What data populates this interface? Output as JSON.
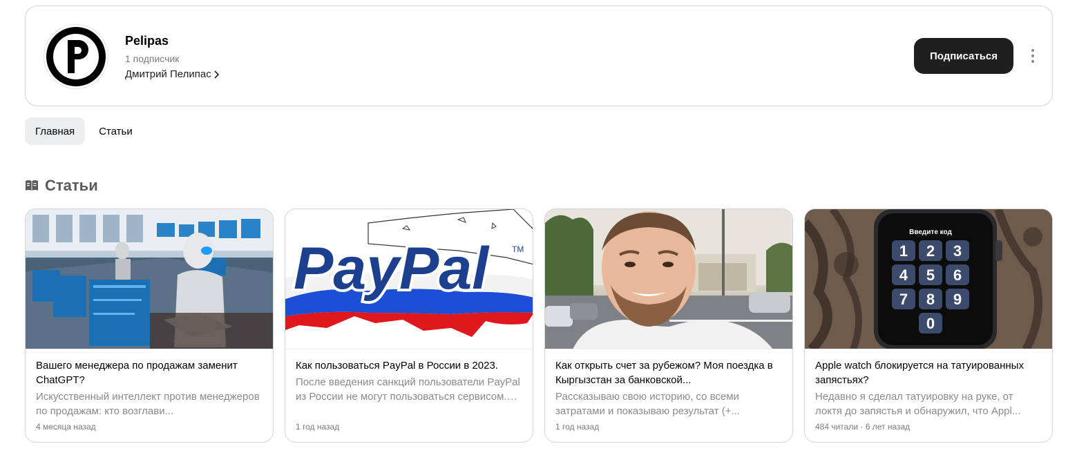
{
  "channel": {
    "name": "Pelipas",
    "subscribers": "1 подписчик",
    "author": "Дмитрий Пелипас",
    "subscribe_label": "Подписаться"
  },
  "tabs": [
    {
      "label": "Главная",
      "active": true
    },
    {
      "label": "Статьи",
      "active": false
    }
  ],
  "section": {
    "title": "Статьи"
  },
  "articles": [
    {
      "title": "Вашего менеджера по продажам заменит ChatGPT?",
      "description": "Искусственный интеллект против менеджеров по продажам: кто возглави...",
      "meta": "4 месяца назад"
    },
    {
      "title": "Как пользоваться PayPal в России в 2023.",
      "description": "После введения санкций пользователи PayPal из России не могут пользоваться сервисом. PayPal ограничивает...",
      "meta": "1 год назад",
      "image_text": "PayPal",
      "image_tm": "TM"
    },
    {
      "title": "Как открыть счет за рубежом? Моя поездка в Кыргызстан за банковской...",
      "description": "Рассказываю свою историю, со всеми затратами и показываю результат (+...",
      "meta": "1 год назад"
    },
    {
      "title": "Apple watch блокируется на татуированных запястьях?",
      "description": "Недавно я сделал татуировку на руке, от локтя до запястья и обнаружил, что Appl...",
      "meta": "484 читали · 6 лет назад",
      "watch_prompt": "Введите код",
      "keypad": [
        "1",
        "2",
        "3",
        "4",
        "5",
        "6",
        "7",
        "8",
        "9",
        "0"
      ]
    }
  ],
  "colors": {
    "button_bg": "#1f1f1f",
    "active_tab_bg": "#eceef0",
    "muted_text": "#8a8a8a"
  }
}
